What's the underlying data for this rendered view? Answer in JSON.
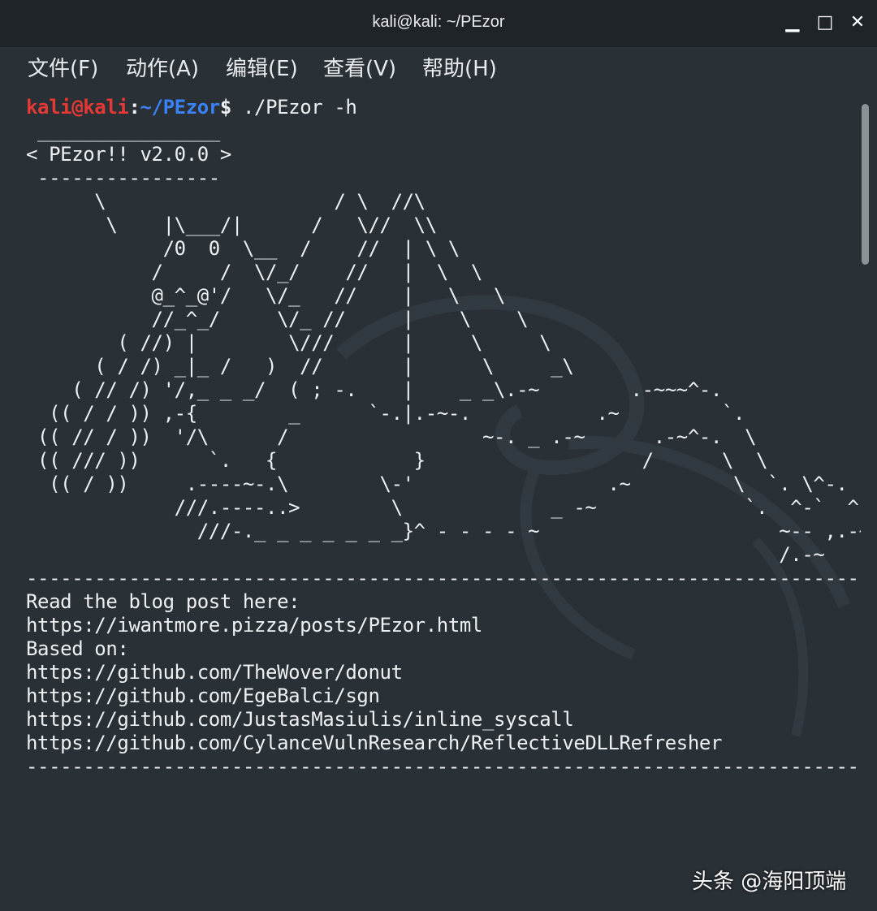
{
  "window": {
    "title": "kali@kali: ~/PEzor",
    "minimize_glyph": "▁",
    "maximize_glyph": "□",
    "close_glyph": "✕"
  },
  "menu": {
    "items": [
      "文件(F)",
      "动作(A)",
      "编辑(E)",
      "查看(V)",
      "帮助(H)"
    ]
  },
  "prompt": {
    "user_host": "kali@kali",
    "colon": ":",
    "path": "~/PEzor",
    "symbol": "$",
    "command": " ./PEzor -h"
  },
  "output": {
    "ascii_art": " ________________\n< PEzor!! v2.0.0 >\n ----------------\n      \\                    / \\  //\\\n       \\    |\\___/|      /   \\//  \\\\\n            /0  0  \\__  /    //  | \\ \\\n           /     /  \\/_/    //   |  \\  \\\n           @_^_@'/   \\/_   //    |   \\   \\\n           //_^_/     \\/_ //     |    \\    \\\n        ( //) |        \\///      |     \\     \\\n      ( / /) _|_ /   )  //       |      \\     _\\\n    ( // /) '/,_ _ _/  ( ; -.    |    _ _\\.-~        .-~~~^-.\n  (( / / )) ,-{        _      `-.|.-~-.           .~         `.\n (( // / ))  '/\\      /                 ~-. _ .-~      .-~^-.  \\\n (( /// ))      `.   {            }                   /      \\  \\\n  (( / ))     .----~-.\\        \\-'                 .~         \\  `. \\^-.\n             ///.----..>        \\             _ -~             `.  ^-`  ^-_\n               ///-._ _ _ _ _ _ _}^ - - - - ~                     ~-- ,.-~\n                                                                  /.-~",
    "separator": "-----------------------------------------------------------------------------------",
    "lines": [
      "Read the blog post here:",
      "https://iwantmore.pizza/posts/PEzor.html",
      "Based on:",
      "https://github.com/TheWover/donut",
      "https://github.com/EgeBalci/sgn",
      "https://github.com/JustasMasiulis/inline_syscall",
      "https://github.com/CylanceVulnResearch/ReflectiveDLLRefresher"
    ]
  },
  "watermark": "头条 @海阳顶端",
  "colors": {
    "background": "#293036",
    "titlebar": "#1f2429",
    "prompt_user": "#e53935",
    "prompt_path": "#3b82f6",
    "text": "#eef0f2"
  }
}
